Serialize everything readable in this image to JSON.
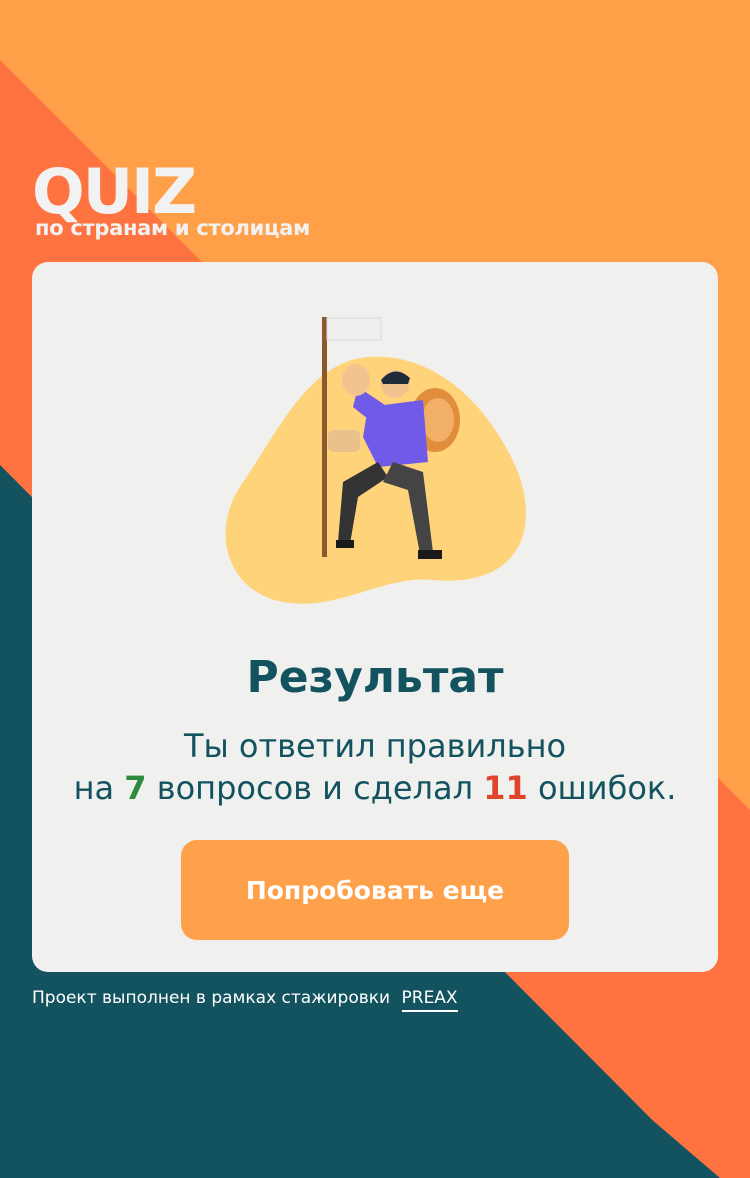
{
  "logo": {
    "title": "QUIZ",
    "subtitle": "по странам и столицам"
  },
  "result": {
    "title": "Результат",
    "line1": "Ты ответил правильно",
    "prefix": "на",
    "correct_count": "7",
    "middle": "вопросов и сделал",
    "wrong_count": "11",
    "suffix": "ошибок."
  },
  "retry_button": {
    "label": "Попробовать еще"
  },
  "footer": {
    "text": "Проект выполнен в рамках стажировки",
    "link_text": "PREAX"
  },
  "colors": {
    "orange_bg": "#FFA048",
    "red_orange": "#FF7340",
    "teal": "#13535F",
    "card": "#F0F0EE",
    "correct": "#2E8B3D",
    "wrong": "#E0442A",
    "button": "#FFA04A"
  },
  "icons": {
    "illustration": "hiker-with-flag-illustration"
  }
}
